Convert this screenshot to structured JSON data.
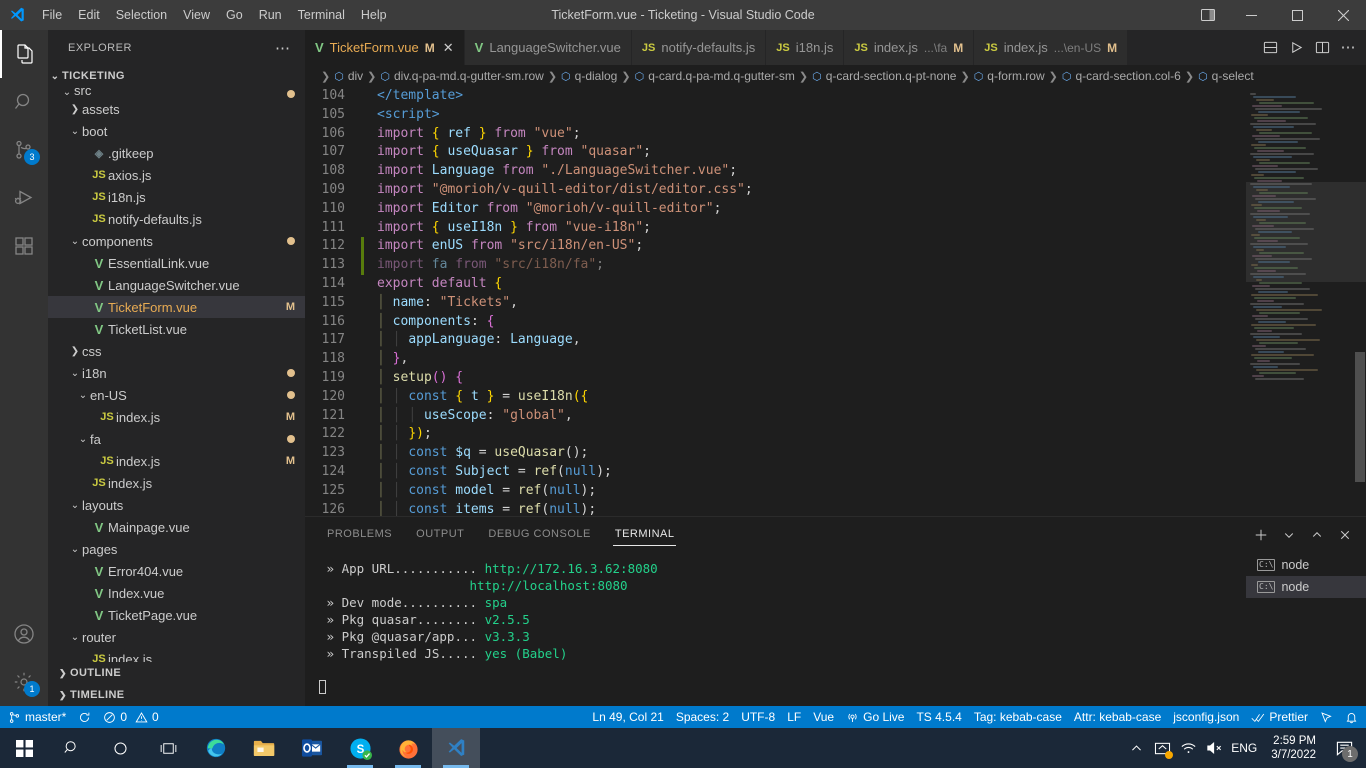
{
  "window": {
    "title": "TicketForm.vue - Ticketing - Visual Studio Code",
    "menu": [
      "File",
      "Edit",
      "Selection",
      "View",
      "Go",
      "Run",
      "Terminal",
      "Help"
    ],
    "controls": {
      "layout_icon": "layout-panel-icon",
      "minimize": "─",
      "maximize": "❐",
      "close": "✕"
    }
  },
  "activitybar": {
    "items": [
      {
        "name": "explorer",
        "icon": "files-icon",
        "badge": ""
      },
      {
        "name": "search",
        "icon": "search-icon",
        "badge": ""
      },
      {
        "name": "source-control",
        "icon": "source-control-icon",
        "badge": "3"
      },
      {
        "name": "run-and-debug",
        "icon": "run-debug-icon",
        "badge": ""
      },
      {
        "name": "extensions",
        "icon": "extensions-icon",
        "badge": ""
      }
    ],
    "bottom": [
      {
        "name": "accounts",
        "icon": "account-icon",
        "badge": ""
      },
      {
        "name": "settings",
        "icon": "gear-icon",
        "badge": "1"
      }
    ]
  },
  "sidebar": {
    "header": "EXPLORER",
    "more_actions": "⋯",
    "root": "TICKETING",
    "tree": [
      {
        "label": "src",
        "indent": 1,
        "type": "folder",
        "state": "open",
        "badge": "dot",
        "partial": true
      },
      {
        "label": "assets",
        "indent": 2,
        "type": "folder",
        "state": "closed",
        "badge": ""
      },
      {
        "label": "boot",
        "indent": 2,
        "type": "folder",
        "state": "open",
        "badge": ""
      },
      {
        "label": ".gitkeep",
        "indent": 3,
        "type": "git",
        "state": "",
        "badge": ""
      },
      {
        "label": "axios.js",
        "indent": 3,
        "type": "js",
        "state": "",
        "badge": ""
      },
      {
        "label": "i18n.js",
        "indent": 3,
        "type": "js",
        "state": "",
        "badge": ""
      },
      {
        "label": "notify-defaults.js",
        "indent": 3,
        "type": "js",
        "state": "",
        "badge": ""
      },
      {
        "label": "components",
        "indent": 2,
        "type": "folder",
        "state": "open",
        "badge": "dot"
      },
      {
        "label": "EssentialLink.vue",
        "indent": 3,
        "type": "vue",
        "state": "",
        "badge": ""
      },
      {
        "label": "LanguageSwitcher.vue",
        "indent": 3,
        "type": "vue",
        "state": "",
        "badge": ""
      },
      {
        "label": "TicketForm.vue",
        "indent": 3,
        "type": "vue",
        "state": "",
        "badge": "M",
        "selected": true
      },
      {
        "label": "TicketList.vue",
        "indent": 3,
        "type": "vue",
        "state": "",
        "badge": ""
      },
      {
        "label": "css",
        "indent": 2,
        "type": "folder",
        "state": "closed",
        "badge": ""
      },
      {
        "label": "i18n",
        "indent": 2,
        "type": "folder",
        "state": "open",
        "badge": "dot"
      },
      {
        "label": "en-US",
        "indent": 3,
        "type": "folder",
        "state": "open",
        "badge": "dot"
      },
      {
        "label": "index.js",
        "indent": 4,
        "type": "js",
        "state": "",
        "badge": "M"
      },
      {
        "label": "fa",
        "indent": 3,
        "type": "folder",
        "state": "open",
        "badge": "dot"
      },
      {
        "label": "index.js",
        "indent": 4,
        "type": "js",
        "state": "",
        "badge": "M"
      },
      {
        "label": "index.js",
        "indent": 3,
        "type": "js",
        "state": "",
        "badge": ""
      },
      {
        "label": "layouts",
        "indent": 2,
        "type": "folder",
        "state": "open",
        "badge": ""
      },
      {
        "label": "Mainpage.vue",
        "indent": 3,
        "type": "vue",
        "state": "",
        "badge": ""
      },
      {
        "label": "pages",
        "indent": 2,
        "type": "folder",
        "state": "open",
        "badge": ""
      },
      {
        "label": "Error404.vue",
        "indent": 3,
        "type": "vue",
        "state": "",
        "badge": ""
      },
      {
        "label": "Index.vue",
        "indent": 3,
        "type": "vue",
        "state": "",
        "badge": ""
      },
      {
        "label": "TicketPage.vue",
        "indent": 3,
        "type": "vue",
        "state": "",
        "badge": ""
      },
      {
        "label": "router",
        "indent": 2,
        "type": "folder",
        "state": "open",
        "badge": ""
      },
      {
        "label": "index.js",
        "indent": 3,
        "type": "js",
        "state": "",
        "badge": ""
      }
    ],
    "sections": [
      {
        "label": "OUTLINE",
        "state": "closed"
      },
      {
        "label": "TIMELINE",
        "state": "closed"
      }
    ]
  },
  "tabs": [
    {
      "label": "TicketForm.vue",
      "desc": "",
      "icon": "vue",
      "modified": "M",
      "active": true,
      "closable": true
    },
    {
      "label": "LanguageSwitcher.vue",
      "desc": "",
      "icon": "vue",
      "modified": "",
      "active": false,
      "closable": false
    },
    {
      "label": "notify-defaults.js",
      "desc": "",
      "icon": "js",
      "modified": "",
      "active": false,
      "closable": false
    },
    {
      "label": "i18n.js",
      "desc": "",
      "icon": "js",
      "modified": "",
      "active": false,
      "closable": false
    },
    {
      "label": "index.js",
      "desc": "...\\fa",
      "icon": "js",
      "modified": "M",
      "active": false,
      "closable": false
    },
    {
      "label": "index.js",
      "desc": "...\\en-US",
      "icon": "js",
      "modified": "M",
      "active": false,
      "closable": false
    }
  ],
  "tab_actions": [
    {
      "name": "split-editor-down-icon",
      "glyph": "⬒"
    },
    {
      "name": "run-or-debug-icon",
      "glyph": "▷"
    },
    {
      "name": "split-editor-right-icon",
      "glyph": "◫"
    },
    {
      "name": "more-actions-icon",
      "glyph": "⋯"
    }
  ],
  "breadcrumb": [
    "div",
    "div.q-pa-md.q-gutter-sm.row",
    "q-dialog",
    "q-card.q-pa-md.q-gutter-sm",
    "q-card-section.q-pt-none",
    "q-form.row",
    "q-card-section.col-6",
    "q-select"
  ],
  "editor": {
    "first_line_number": 104,
    "lines": [
      {
        "n": 104,
        "git": "",
        "html": "<span class='ctext'><span class='t-tag'>&lt;/template&gt;</span></span>"
      },
      {
        "n": 105,
        "git": "",
        "html": "<span class='ctext'><span class='t-tag'>&lt;script&gt;</span></span>"
      },
      {
        "n": 106,
        "git": "",
        "html": "<span class='ctext'><span class='t-kw'>import</span> <span class='t-brace'>{</span> <span class='t-var'>ref</span> <span class='t-brace'>}</span> <span class='t-kw'>from</span> <span class='t-str'>\"vue\"</span><span class='t-plain'>;</span></span>"
      },
      {
        "n": 107,
        "git": "",
        "html": "<span class='ctext'><span class='t-kw'>import</span> <span class='t-brace'>{</span> <span class='t-var'>useQuasar</span> <span class='t-brace'>}</span> <span class='t-kw'>from</span> <span class='t-str'>\"quasar\"</span><span class='t-plain'>;</span></span>"
      },
      {
        "n": 108,
        "git": "",
        "html": "<span class='ctext'><span class='t-kw'>import</span> <span class='t-var'>Language</span> <span class='t-kw'>from</span> <span class='t-str'>\"./LanguageSwitcher.vue\"</span><span class='t-plain'>;</span></span>"
      },
      {
        "n": 109,
        "git": "",
        "html": "<span class='ctext'><span class='t-kw'>import</span> <span class='t-str'>\"@morioh/v-quill-editor/dist/editor.css\"</span><span class='t-plain'>;</span></span>"
      },
      {
        "n": 110,
        "git": "",
        "html": "<span class='ctext'><span class='t-kw'>import</span> <span class='t-var'>Editor</span> <span class='t-kw'>from</span> <span class='t-str'>\"@morioh/v-quill-editor\"</span><span class='t-plain'>;</span></span>"
      },
      {
        "n": 111,
        "git": "",
        "html": "<span class='ctext'><span class='t-kw'>import</span> <span class='t-brace'>{</span> <span class='t-var'>useI18n</span> <span class='t-brace'>}</span> <span class='t-kw'>from</span> <span class='t-str'>\"vue-i18n\"</span><span class='t-plain'>;</span></span>"
      },
      {
        "n": 112,
        "git": "add",
        "html": "<span class='ctext'><span class='t-kw'>import</span> <span class='t-var'>enUS</span> <span class='t-kw'>from</span> <span class='t-str'>\"src/i18n/en-US\"</span><span class='t-plain'>;</span></span>"
      },
      {
        "n": 113,
        "git": "add",
        "html": "<span class='ctext t-dim'><span class='t-kw'>import</span> <span class='t-var'>fa</span> <span class='t-kw'>from</span> <span class='t-str'>\"src/i18n/fa\"</span><span class='t-plain'>;</span></span>"
      },
      {
        "n": 114,
        "git": "",
        "html": "<span class='ctext'><span class='t-kw'>export</span> <span class='t-kw'>default</span> <span class='t-brace'>{</span></span>"
      },
      {
        "n": 115,
        "git": "",
        "html": "<span class='ctext'><span class='ind-active'>│</span> <span class='t-var'>name</span><span class='t-plain'>: </span><span class='t-str'>\"Tickets\"</span><span class='t-plain'>,</span></span>"
      },
      {
        "n": 116,
        "git": "",
        "html": "<span class='ctext'><span class='ind-active'>│</span> <span class='t-var'>components</span><span class='t-plain'>: </span><span class='t-brace2'>{</span></span>"
      },
      {
        "n": 117,
        "git": "",
        "html": "<span class='ctext'><span class='ind-active'>│</span> <span class='ind-guide'>│</span> <span class='t-var'>appLanguage</span><span class='t-plain'>: </span><span class='t-var'>Language</span><span class='t-plain'>,</span></span>"
      },
      {
        "n": 118,
        "git": "",
        "html": "<span class='ctext'><span class='ind-active'>│</span> <span class='t-brace2'>}</span><span class='t-plain'>,</span></span>"
      },
      {
        "n": 119,
        "git": "",
        "html": "<span class='ctext'><span class='ind-active'>│</span> <span class='t-fn'>setup</span><span class='t-brace2'>()</span> <span class='t-brace2'>{</span></span>"
      },
      {
        "n": 120,
        "git": "",
        "html": "<span class='ctext'><span class='ind-active'>│</span> <span class='ind-guide'>│</span> <span class='t-kw2'>const</span> <span class='t-brace'>{</span> <span class='t-var'>t</span> <span class='t-brace'>}</span> <span class='t-plain'>= </span><span class='t-fn'>useI18n</span><span class='t-brace'>({</span></span>"
      },
      {
        "n": 121,
        "git": "",
        "html": "<span class='ctext'><span class='ind-active'>│</span> <span class='ind-guide'>│</span> <span class='ind-guide'>│</span> <span class='t-var'>useScope</span><span class='t-plain'>: </span><span class='t-str'>\"global\"</span><span class='t-plain'>,</span></span>"
      },
      {
        "n": 122,
        "git": "",
        "html": "<span class='ctext'><span class='ind-active'>│</span> <span class='ind-guide'>│</span> <span class='t-brace'>})</span><span class='t-plain'>;</span></span>"
      },
      {
        "n": 123,
        "git": "",
        "html": "<span class='ctext'><span class='ind-active'>│</span> <span class='ind-guide'>│</span> <span class='t-kw2'>const</span> <span class='t-var'>$q</span> <span class='t-plain'>= </span><span class='t-fn'>useQuasar</span><span class='t-plain'>();</span></span>"
      },
      {
        "n": 124,
        "git": "",
        "html": "<span class='ctext'><span class='ind-active'>│</span> <span class='ind-guide'>│</span> <span class='t-kw2'>const</span> <span class='t-var'>Subject</span> <span class='t-plain'>= </span><span class='t-fn'>ref</span><span class='t-plain'>(</span><span class='t-kw2'>null</span><span class='t-plain'>);</span></span>"
      },
      {
        "n": 125,
        "git": "",
        "html": "<span class='ctext'><span class='ind-active'>│</span> <span class='ind-guide'>│</span> <span class='t-kw2'>const</span> <span class='t-var'>model</span> <span class='t-plain'>= </span><span class='t-fn'>ref</span><span class='t-plain'>(</span><span class='t-kw2'>null</span><span class='t-plain'>);</span></span>"
      },
      {
        "n": 126,
        "git": "",
        "html": "<span class='ctext'><span class='ind-active'>│</span> <span class='ind-guide'>│</span> <span class='t-kw2'>const</span> <span class='t-var'>items</span> <span class='t-plain'>= </span><span class='t-fn'>ref</span><span class='t-plain'>(</span><span class='t-kw2'>null</span><span class='t-plain'>);</span></span>"
      }
    ]
  },
  "panel": {
    "tabs": [
      {
        "label": "PROBLEMS",
        "active": false
      },
      {
        "label": "OUTPUT",
        "active": false
      },
      {
        "label": "DEBUG CONSOLE",
        "active": false
      },
      {
        "label": "TERMINAL",
        "active": true
      }
    ],
    "actions": [
      {
        "name": "new-terminal-icon",
        "glyph": "+"
      },
      {
        "name": "terminal-dropdown-icon",
        "glyph": "⌄"
      },
      {
        "name": "maximize-panel-icon",
        "glyph": "⌃"
      },
      {
        "name": "close-panel-icon",
        "glyph": "✕"
      }
    ],
    "terminal_lines": [
      {
        "prefix": " » ",
        "key": "App URL...........",
        "value": "http://172.16.3.62:8080"
      },
      {
        "prefix": "",
        "key": "                   ",
        "value": "http://localhost:8080"
      },
      {
        "prefix": " » ",
        "key": "Dev mode..........",
        "value": "spa"
      },
      {
        "prefix": " » ",
        "key": "Pkg quasar........",
        "value": "v2.5.5"
      },
      {
        "prefix": " » ",
        "key": "Pkg @quasar/app...",
        "value": "v3.3.3"
      },
      {
        "prefix": " » ",
        "key": "Transpiled JS.....",
        "value": "yes (Babel)"
      }
    ],
    "terminal_list": [
      {
        "label": "node",
        "active": false
      },
      {
        "label": "node",
        "active": true
      }
    ]
  },
  "statusbar": {
    "left": [
      {
        "name": "remote-branch",
        "icon": "source-control-icon",
        "label": "master*"
      },
      {
        "name": "sync-changes",
        "icon": "sync-icon",
        "label": ""
      },
      {
        "name": "problems",
        "icon": "error-warning-icon",
        "label": "0  0"
      }
    ],
    "branch": "master*",
    "errors": "0",
    "warnings": "0",
    "right": [
      {
        "name": "editor-position",
        "label": "Ln 49, Col 21"
      },
      {
        "name": "indentation",
        "label": "Spaces: 2"
      },
      {
        "name": "encoding",
        "label": "UTF-8"
      },
      {
        "name": "eol",
        "label": "LF"
      },
      {
        "name": "language-mode",
        "label": "Vue"
      },
      {
        "name": "go-live",
        "label": "Go Live",
        "icon": "broadcast-icon"
      },
      {
        "name": "typescript-version",
        "label": "TS 4.5.4"
      },
      {
        "name": "tag-case",
        "label": "Tag: kebab-case"
      },
      {
        "name": "attr-case",
        "label": "Attr: kebab-case"
      },
      {
        "name": "jsconfig",
        "label": "jsconfig.json"
      },
      {
        "name": "prettier",
        "label": "Prettier",
        "icon": "checks-icon"
      },
      {
        "name": "remote-indicator",
        "label": "",
        "icon": "feedback-icon"
      },
      {
        "name": "notifications",
        "label": "",
        "icon": "bell-icon"
      }
    ]
  },
  "taskbar": {
    "items": [
      {
        "name": "start-button",
        "icon": "windows-icon",
        "running": false,
        "active": false
      },
      {
        "name": "search-button",
        "icon": "search-icon",
        "running": false,
        "active": false
      },
      {
        "name": "cortana-button",
        "icon": "circle-icon",
        "running": false,
        "active": false
      },
      {
        "name": "task-view-button",
        "icon": "task-view-icon",
        "running": false,
        "active": false
      },
      {
        "name": "edge-button",
        "icon": "edge-icon",
        "running": false,
        "active": false
      },
      {
        "name": "file-explorer-button",
        "icon": "folder-icon",
        "running": false,
        "active": false
      },
      {
        "name": "outlook-button",
        "icon": "outlook-icon",
        "running": false,
        "active": false
      },
      {
        "name": "skype-button",
        "icon": "skype-icon",
        "running": true,
        "active": false
      },
      {
        "name": "firefox-button",
        "icon": "firefox-icon",
        "running": true,
        "active": false
      },
      {
        "name": "vscode-button",
        "icon": "vscode-icon",
        "running": true,
        "active": true
      }
    ],
    "tray": [
      {
        "name": "show-hidden-icons",
        "glyph": "∧"
      },
      {
        "name": "onedrive-icon",
        "glyph": ""
      },
      {
        "name": "network-icon",
        "glyph": ""
      },
      {
        "name": "volume-muted-icon",
        "glyph": ""
      }
    ],
    "language": "ENG",
    "time": "2:59 PM",
    "date": "3/7/2022",
    "notification_count": "1"
  },
  "colors": {
    "accent": "#007acc",
    "titlebar": "#3c3c3c",
    "sidebar": "#252526",
    "editor": "#1e1e1e",
    "modified_badge": "#e2c08d",
    "git_added": "#587c0c",
    "taskbar": "#1b2838"
  }
}
